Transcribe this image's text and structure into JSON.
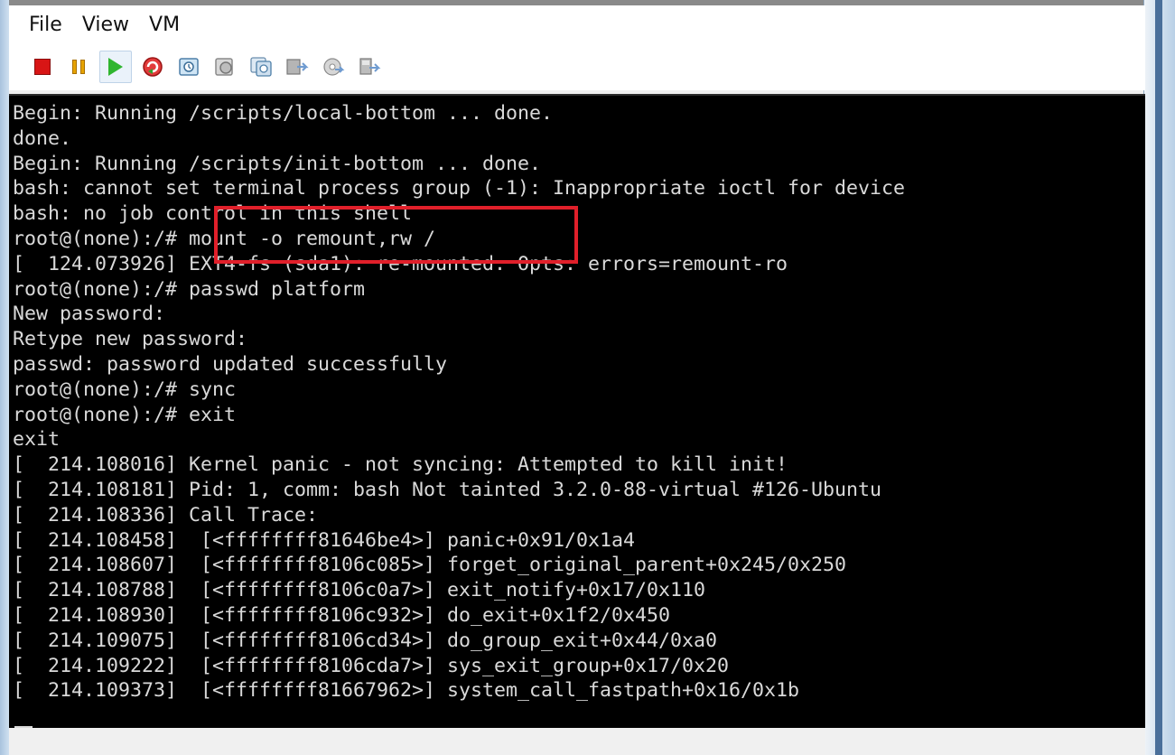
{
  "menu": {
    "file": "File",
    "view": "View",
    "vm": "VM"
  },
  "toolbar": {
    "icons": [
      "stop-icon",
      "pause-icon",
      "play-icon",
      "reset-icon",
      "snapshot-icon",
      "revert-snapshot-icon",
      "manage-snapshots-icon",
      "console-icon",
      "cd-dvd-icon",
      "floppy-icon"
    ]
  },
  "terminal": {
    "lines": [
      "Begin: Running /scripts/local-bottom ... done.",
      "done.",
      "Begin: Running /scripts/init-bottom ... done.",
      "bash: cannot set terminal process group (-1): Inappropriate ioctl for device",
      "bash: no job control in this shell",
      "root@(none):/# mount -o remount,rw /",
      "[  124.073926] EXT4-fs (sda1): re-mounted. Opts: errors=remount-ro",
      "root@(none):/# passwd platform",
      "New password:",
      "Retype new password:",
      "passwd: password updated successfully",
      "root@(none):/# sync",
      "root@(none):/# exit",
      "exit",
      "[  214.108016] Kernel panic - not syncing: Attempted to kill init!",
      "[  214.108181] Pid: 1, comm: bash Not tainted 3.2.0-88-virtual #126-Ubuntu",
      "[  214.108336] Call Trace:",
      "[  214.108458]  [<ffffffff81646be4>] panic+0x91/0x1a4",
      "[  214.108607]  [<ffffffff8106c085>] forget_original_parent+0x245/0x250",
      "[  214.108788]  [<ffffffff8106c0a7>] exit_notify+0x17/0x110",
      "[  214.108930]  [<ffffffff8106c932>] do_exit+0x1f2/0x450",
      "[  214.109075]  [<ffffffff8106cd34>] do_group_exit+0x44/0xa0",
      "[  214.109222]  [<ffffffff8106cda7>] sys_exit_group+0x17/0x20",
      "[  214.109373]  [<ffffffff81667962>] system_call_fastpath+0x16/0x1b"
    ]
  },
  "colors": {
    "terminal_bg": "#000000",
    "terminal_text": "#d9d9d9",
    "highlight": "#e01f2a"
  }
}
